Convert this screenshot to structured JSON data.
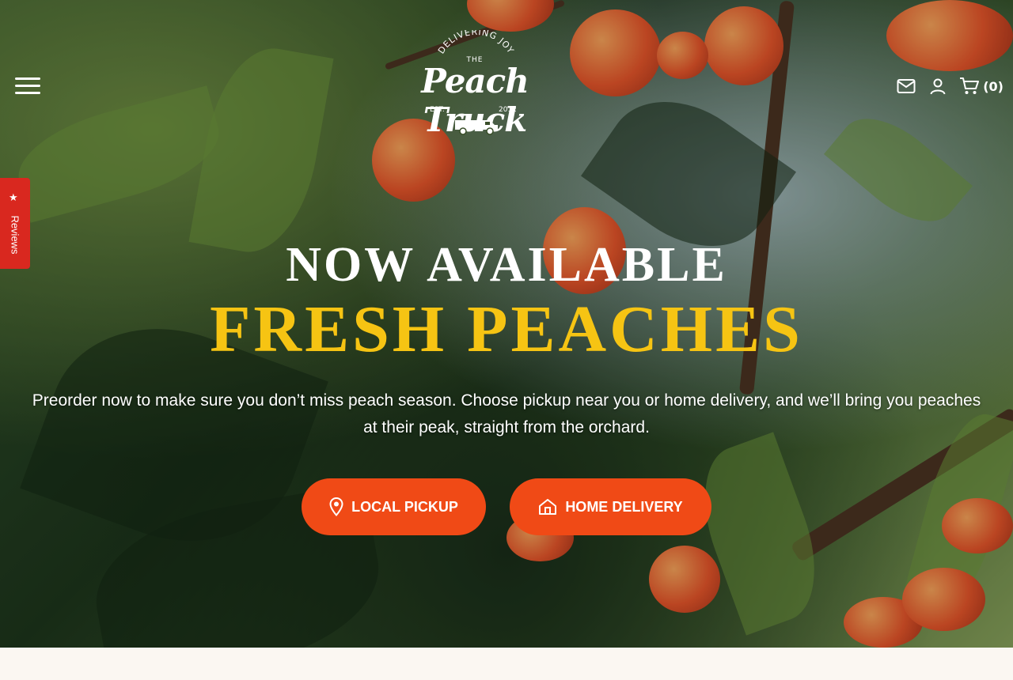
{
  "header": {
    "logo": {
      "arc_text": "DELIVERING JOY",
      "prefix": "THE",
      "name": "Peach Truck",
      "est": "EST.",
      "year": "2012"
    },
    "cart_count": "(0)"
  },
  "icons": {
    "menu": "hamburger-menu-icon",
    "mail": "envelope-icon",
    "account": "user-icon",
    "cart": "shopping-cart-icon",
    "pickup": "map-pin-icon",
    "delivery": "home-icon",
    "reviews": "star-icon"
  },
  "reviews_tab": {
    "star": "★",
    "label": "Reviews"
  },
  "hero": {
    "headline_line1": "NOW AVAILABLE",
    "headline_line2": "FRESH PEACHES",
    "subtitle": "Preorder now to make sure you don’t miss peach season. Choose pickup near you or home delivery, and we’ll bring you peaches at their peak, straight from the orchard.",
    "buttons": {
      "pickup_label": "LOCAL PICKUP",
      "delivery_label": "HOME DELIVERY"
    }
  },
  "colors": {
    "headline_white": "#ffffff",
    "headline_yellow": "#f6c413",
    "button_orange": "#f04a16",
    "reviews_red": "#d9281f",
    "page_bg": "#fbf7f2"
  }
}
